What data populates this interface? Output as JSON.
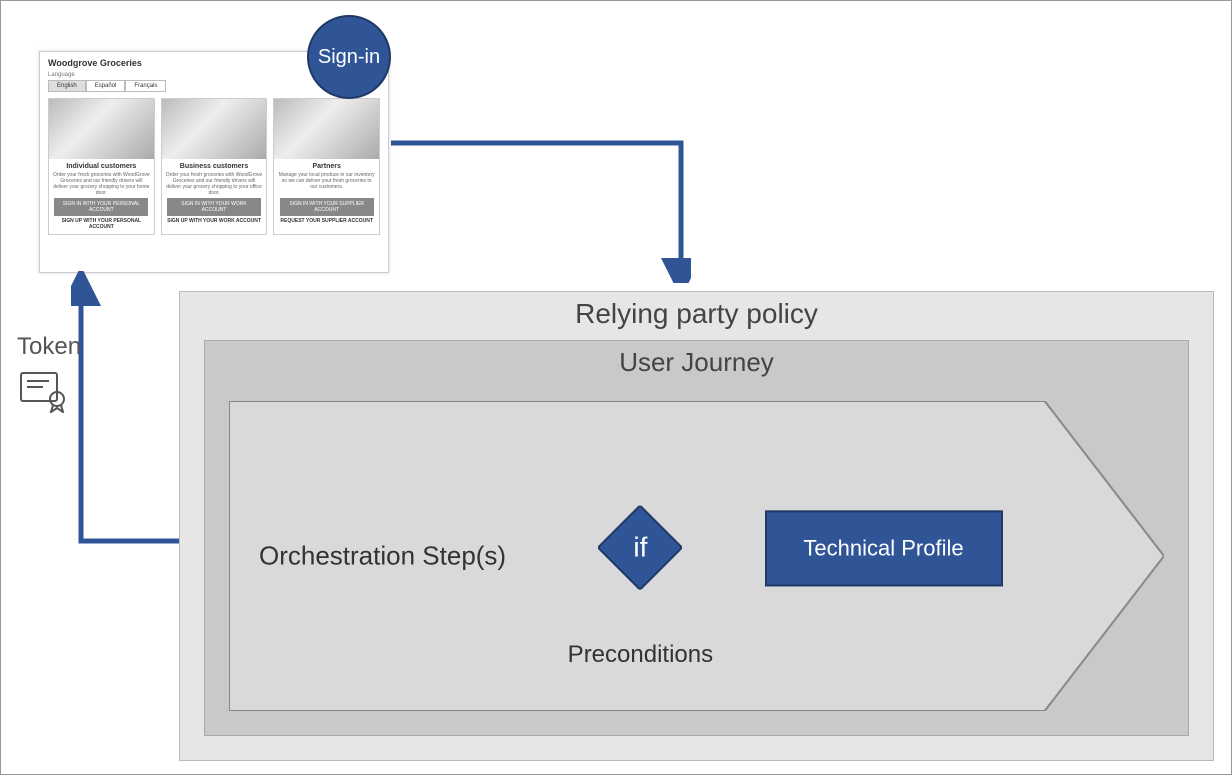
{
  "signin_label": "Sign-in",
  "token_label": "Token",
  "relying_party_title": "Relying party policy",
  "user_journey_title": "User Journey",
  "orchestration_label": "Orchestration Step(s)",
  "preconditions": {
    "if_label": "if",
    "title": "Preconditions"
  },
  "technical_profile_label": "Technical Profile",
  "woodgrove": {
    "title": "Woodgrove Groceries",
    "language_label": "Language",
    "tabs": [
      "English",
      "Español",
      "Français"
    ],
    "cards": [
      {
        "heading": "Individual customers",
        "desc": "Order your fresh groceries with WoodGrove Groceries and our friendly drivers will deliver your grocery shopping to your home door.",
        "btn1": "SIGN IN WITH YOUR PERSONAL ACCOUNT",
        "btn2": "SIGN UP WITH YOUR PERSONAL ACCOUNT"
      },
      {
        "heading": "Business customers",
        "desc": "Order your fresh groceries with WoodGrove Groceries and our friendly drivers will deliver your grocery shopping to your office door.",
        "btn1": "SIGN IN WITH YOUR WORK ACCOUNT",
        "btn2": "SIGN UP WITH YOUR WORK ACCOUNT"
      },
      {
        "heading": "Partners",
        "desc": "Manage your local produce in our inventory so we can deliver your fresh groceries to our customers.",
        "btn1": "SIGN IN WITH YOUR SUPPLIER ACCOUNT",
        "btn2": "REQUEST YOUR SUPPLIER ACCOUNT"
      }
    ]
  }
}
